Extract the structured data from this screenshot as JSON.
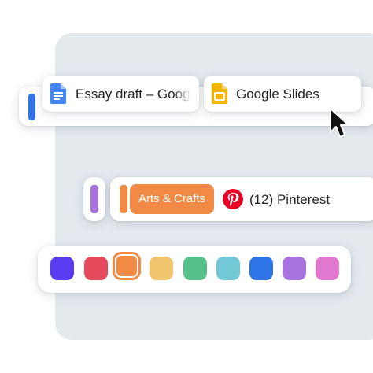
{
  "groups": {
    "blue": {
      "color": "#2f74e6"
    },
    "purple": {
      "color": "#a873e0"
    },
    "orange": {
      "color": "#f08a45",
      "label": "Arts & Crafts"
    }
  },
  "tabs": [
    {
      "title": "Essay draft – Google Docs",
      "icon": "google-docs-icon"
    },
    {
      "title": "Google Slides",
      "icon": "google-slides-icon"
    },
    {
      "title": "(12) Pinterest",
      "icon": "pinterest-icon"
    }
  ],
  "colors": [
    {
      "name": "indigo",
      "hex": "#5b3bf0",
      "selected": false
    },
    {
      "name": "red",
      "hex": "#e44a5c",
      "selected": false
    },
    {
      "name": "orange",
      "hex": "#f08a45",
      "selected": true
    },
    {
      "name": "yellow",
      "hex": "#f2c46e",
      "selected": false
    },
    {
      "name": "green",
      "hex": "#55c18a",
      "selected": false
    },
    {
      "name": "cyan",
      "hex": "#72c8d6",
      "selected": false
    },
    {
      "name": "blue",
      "hex": "#2f74e6",
      "selected": false
    },
    {
      "name": "purple",
      "hex": "#a873e0",
      "selected": false
    },
    {
      "name": "pink",
      "hex": "#e277cf",
      "selected": false
    }
  ]
}
